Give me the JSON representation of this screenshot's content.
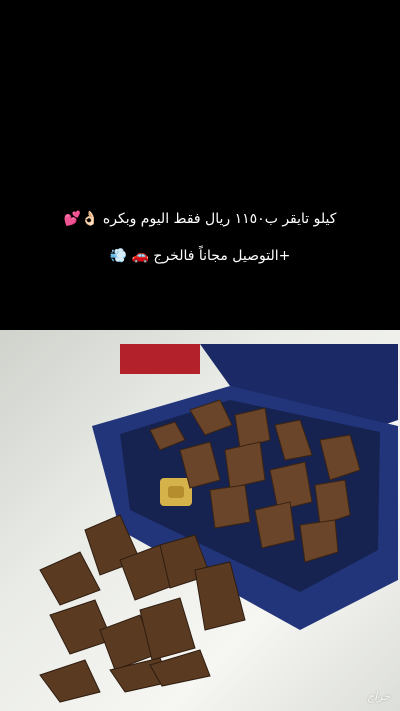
{
  "story": {
    "caption_line_1": "كيلو تايقر ب١١٥٠ ريال فقط اليوم وبكره 👌🏻💕",
    "caption_line_2": "+التوصيل مجاناً فالخرج 🚗 💨",
    "watermark": "حراج"
  },
  "colors": {
    "background": "#000000",
    "box_blue": "#1f2f6e",
    "wood_brown": "#5a3b22"
  }
}
